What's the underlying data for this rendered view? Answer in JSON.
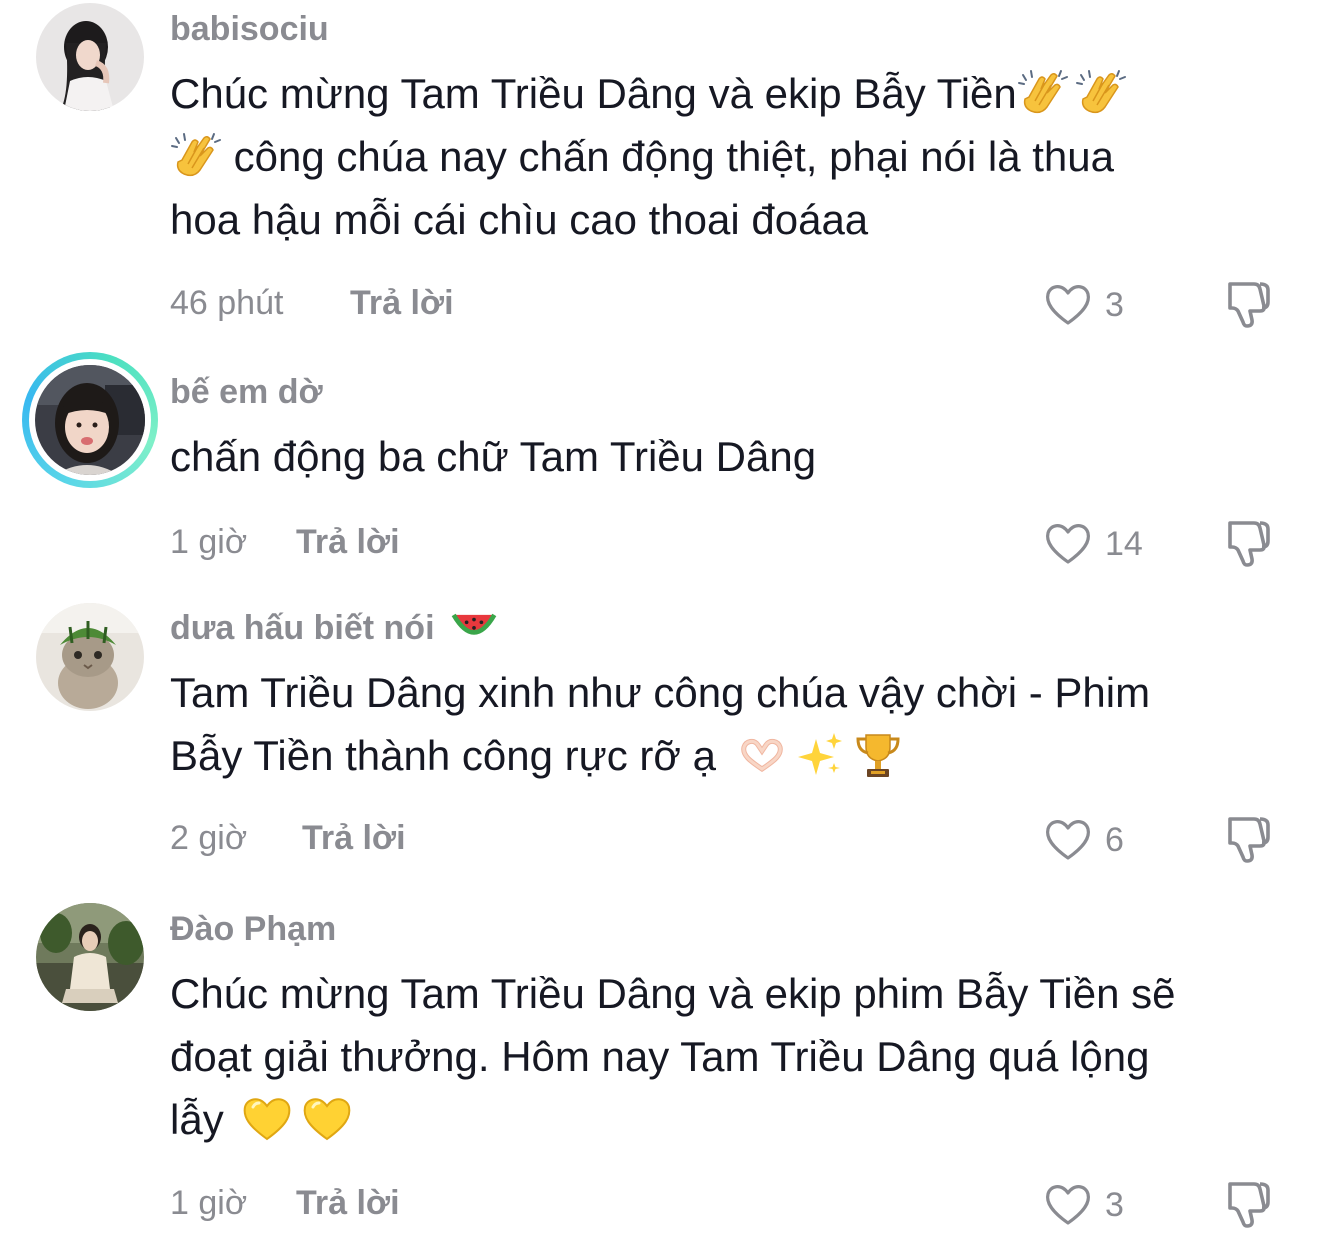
{
  "comments": [
    {
      "username": "babisociu",
      "text_1": "Chúc mừng Tam Triều Dâng và ekip Bẫy Tiền",
      "text_2": " công chúa nay chấn động thiệt, phại nói là thua",
      "text_3": "hoa hậu mỗi cái chìu cao thoai đoáaa",
      "time": "46 phút",
      "reply": "Trả lời",
      "likes": "3",
      "emojis": [
        "clapping-hands",
        "clapping-hands",
        "clapping-hands"
      ]
    },
    {
      "username": "bế em dờ",
      "text_1": "chấn động ba chữ Tam Triều Dâng",
      "time": "1 giờ",
      "reply": "Trả lời",
      "likes": "14",
      "has_story_ring": true
    },
    {
      "username": "dưa hấu biết nói",
      "username_emoji": "watermelon",
      "text_1": "Tam Triều Dâng xinh như công chúa vậy chời - Phim",
      "text_2": "Bẫy Tiền thành công rực rỡ ạ",
      "time": "2 giờ",
      "reply": "Trả lời",
      "likes": "6",
      "emojis": [
        "heart-hands",
        "sparkles",
        "trophy"
      ]
    },
    {
      "username": "Đào Phạm",
      "text_1": "Chúc mừng Tam Triều Dâng và ekip phim Bẫy Tiền sẽ",
      "text_2": "đoạt giải thưởng. Hôm nay Tam Triều Dâng quá lộng",
      "text_3": "lẫy",
      "time": "1 giờ",
      "reply": "Trả lời",
      "likes": "3",
      "emojis": [
        "yellow-heart",
        "yellow-heart"
      ]
    }
  ],
  "colors": {
    "text": "#161823",
    "secondary": "#8a8b91",
    "ring_start": "#38b8f0",
    "ring_end": "#7ff0c8"
  }
}
